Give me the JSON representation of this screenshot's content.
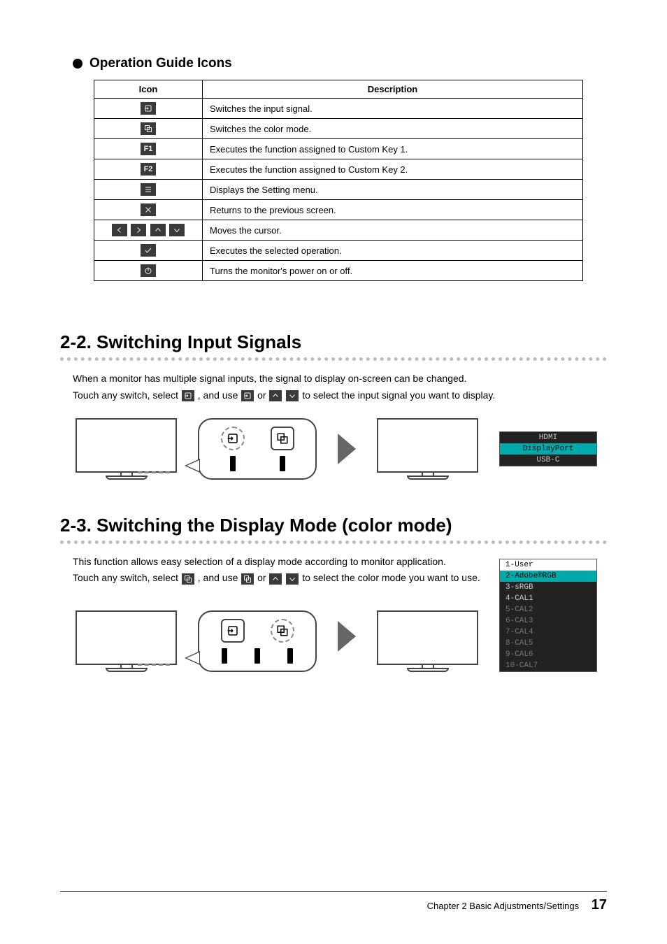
{
  "heading_icons": "Operation Guide Icons",
  "tbl": {
    "hdr_icon": "Icon",
    "hdr_desc": "Description",
    "rows": [
      {
        "desc": "Switches the input signal."
      },
      {
        "desc": "Switches the color mode."
      },
      {
        "desc": "Executes the function assigned to Custom Key 1."
      },
      {
        "desc": "Executes the function assigned to Custom Key 2."
      },
      {
        "desc": "Displays the Setting menu."
      },
      {
        "desc": "Returns to the previous screen."
      },
      {
        "desc": "Moves the cursor."
      },
      {
        "desc": "Executes the selected operation."
      },
      {
        "desc": "Turns the monitor's power on or off."
      }
    ],
    "f1": "F1",
    "f2": "F2"
  },
  "sec22": {
    "title": "2-2.  Switching Input Signals",
    "p1": "When a monitor has multiple signal inputs, the signal to display on-screen can be changed.",
    "p2a": "Touch any switch, select ",
    "p2b": " , and use ",
    "p2c": " or ",
    "p2d": " to select the input signal you want to display."
  },
  "input_menu": {
    "i1": "HDMI",
    "i2": "DisplayPort",
    "i3": "USB-C"
  },
  "sec23": {
    "title": "2-3.  Switching the Display Mode (color mode)",
    "p1": "This function allows easy selection of a display mode according to monitor application.",
    "p2a": "Touch any switch, select ",
    "p2b": ", and use ",
    "p2c": " or ",
    "p2d": " to select the color mode you want to use."
  },
  "color_menu": {
    "m1": "1-User",
    "m2": "2-Adobe®RGB",
    "m3": "3-sRGB",
    "m4": "4-CAL1",
    "m5": "5-CAL2",
    "m6": "6-CAL3",
    "m7": "7-CAL4",
    "m8": "8-CAL5",
    "m9": "9-CAL6",
    "m10": "10-CAL7"
  },
  "footer": {
    "chapter": "Chapter 2    Basic Adjustments/Settings",
    "page": "17"
  }
}
